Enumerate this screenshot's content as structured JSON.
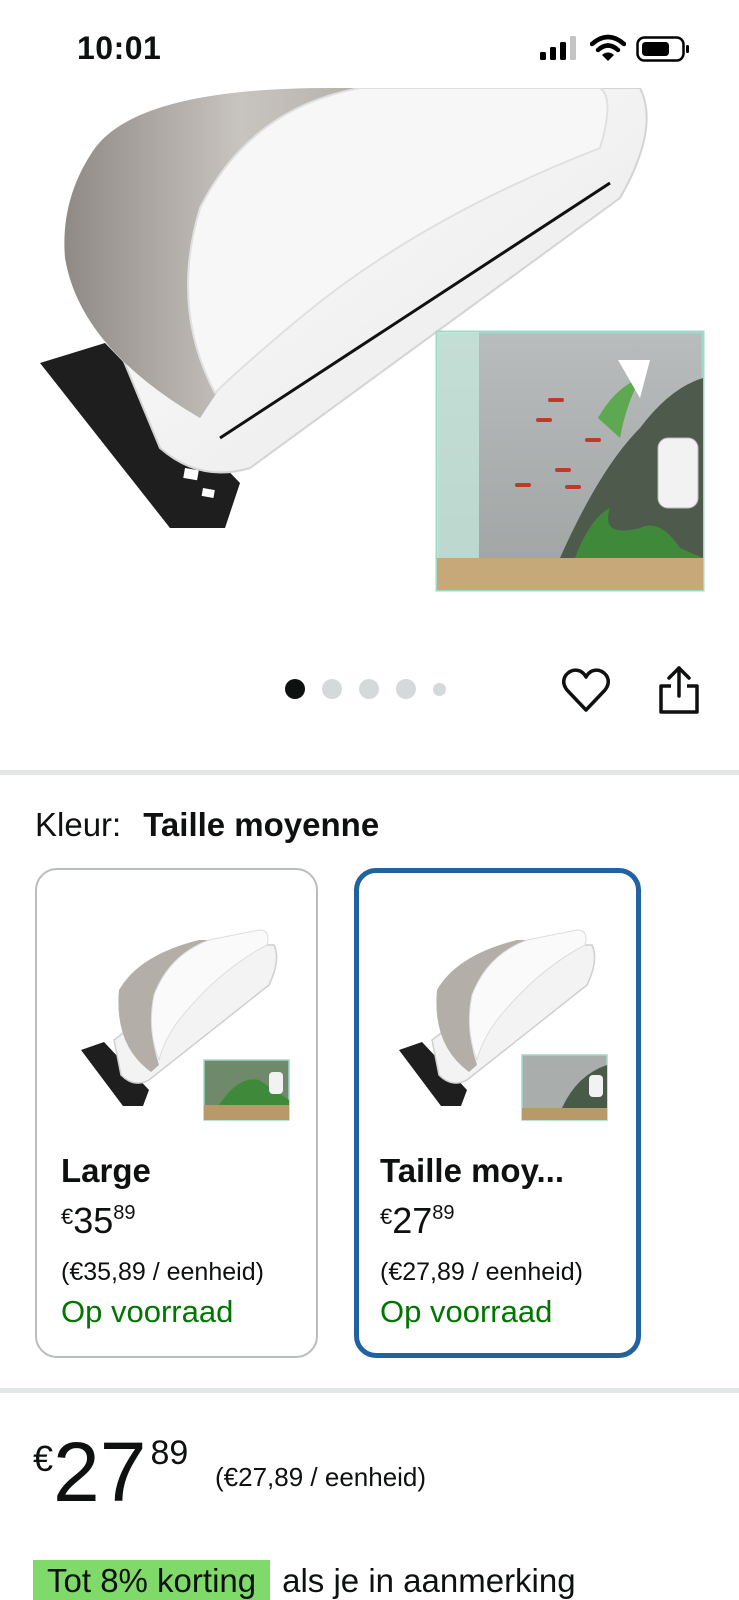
{
  "status_bar": {
    "time": "10:01"
  },
  "product": {
    "image_pager": {
      "count": 5,
      "active_index": 0
    }
  },
  "variation": {
    "label": "Kleur:",
    "selected_value": "Taille moyenne",
    "options": [
      {
        "name": "Large",
        "price_currency": "€",
        "price_whole": "35",
        "price_fraction": "89",
        "unit_price": "(€35,89 / eenheid)",
        "availability": "Op voorraad",
        "selected": false
      },
      {
        "name": "Taille moy...",
        "price_currency": "€",
        "price_whole": "27",
        "price_fraction": "89",
        "unit_price": "(€27,89 / eenheid)",
        "availability": "Op voorraad",
        "selected": true
      }
    ]
  },
  "price": {
    "currency": "€",
    "whole": "27",
    "fraction": "89",
    "unit_price": "(€27,89 / eenheid)"
  },
  "discount": {
    "badge": "Tot 8% korting",
    "text": "als je in aanmerking"
  },
  "colors": {
    "selected_border": "#2162a1",
    "in_stock": "#007600",
    "discount_badge": "#7fda69"
  }
}
